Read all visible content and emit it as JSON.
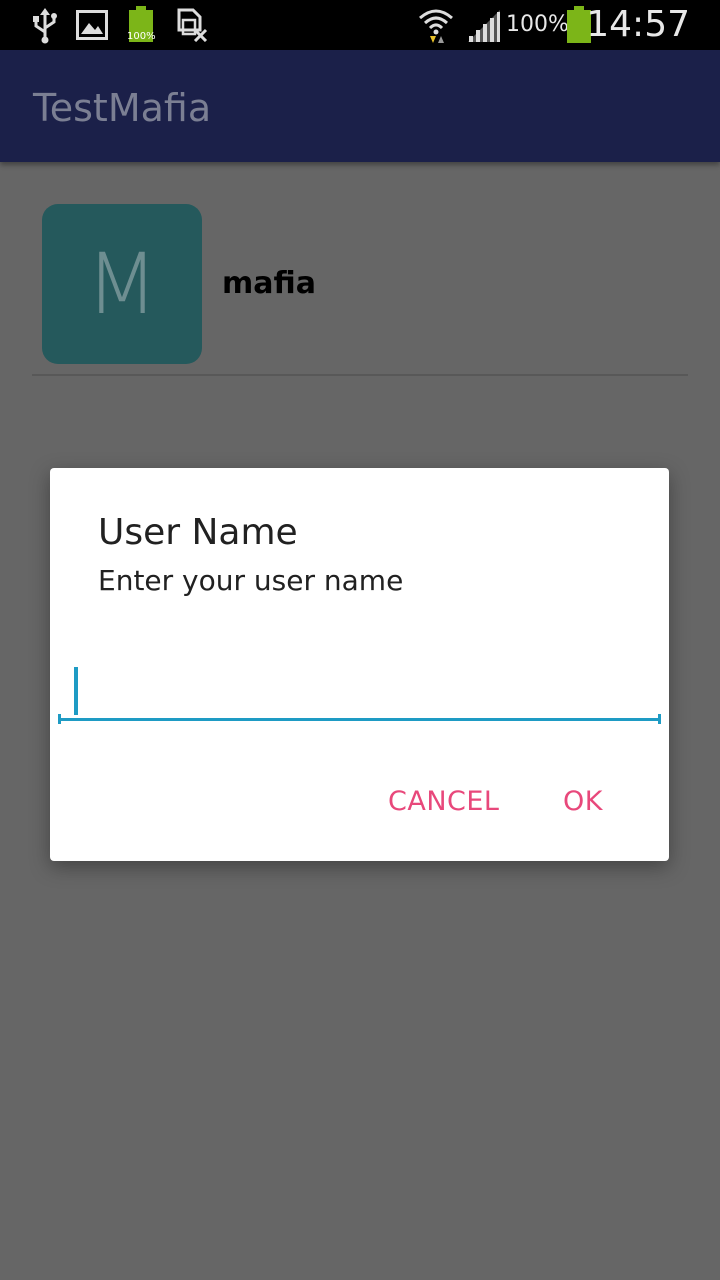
{
  "status_bar": {
    "icons": [
      "usb-icon",
      "image-icon",
      "battery-small-icon",
      "sim-no-icon",
      "wifi-icon",
      "signal-icon",
      "battery-icon"
    ],
    "battery_small_label": "100%",
    "battery_percent": "100%",
    "time": "14:57"
  },
  "app_bar": {
    "title": "TestMafia"
  },
  "list": {
    "items": [
      {
        "avatar_letter": "M",
        "name": "mafia"
      }
    ]
  },
  "dialog": {
    "title": "User Name",
    "message": "Enter your user name",
    "input_value": "",
    "cancel_label": "CANCEL",
    "ok_label": "OK"
  },
  "colors": {
    "accent": "#e8487b",
    "input_underline": "#1e9bc4",
    "scrim": "#666666",
    "app_bar": "#1b2049",
    "avatar": "#25595c"
  }
}
